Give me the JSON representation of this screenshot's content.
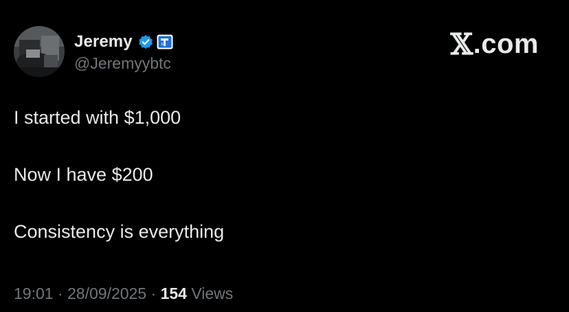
{
  "author": {
    "display_name": "Jeremy",
    "handle": "@Jeremyybtc",
    "avatar_icon": "person-photo-avatar",
    "verified_icon": "verified-badge-icon",
    "affiliate_icon": "affiliate-badge-icon",
    "verified_color": "#1d9bf0"
  },
  "brand": {
    "x_mark": "𝕏",
    "suffix": ".com"
  },
  "tweet": {
    "lines": [
      "I started with $1,000",
      "Now I have $200",
      "Consistency is everything"
    ]
  },
  "meta": {
    "time": "19:01",
    "separator": "·",
    "date": "28/09/2025",
    "views_count": "154",
    "views_label": "Views"
  },
  "colors": {
    "background": "#000000",
    "primary_text": "#e7e9ea",
    "secondary_text": "#71767b"
  }
}
